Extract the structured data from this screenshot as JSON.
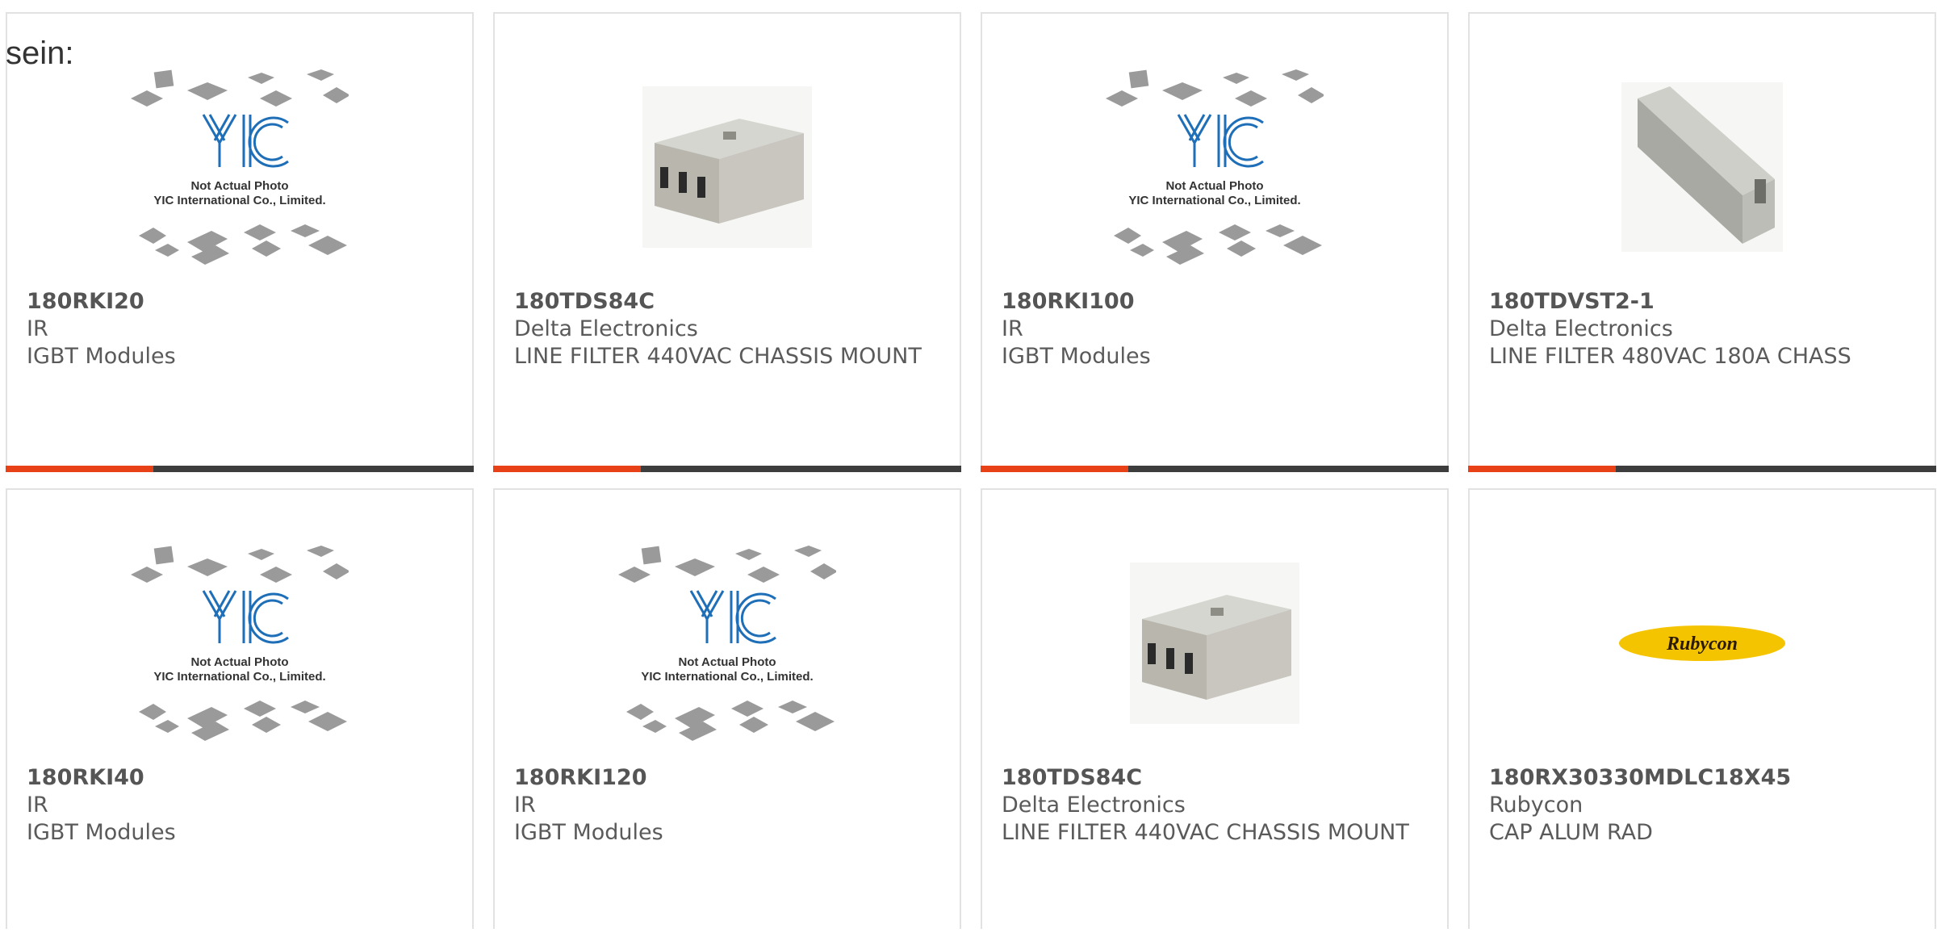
{
  "intro_text": "sein:",
  "placeholder": {
    "line1": "Not Actual Photo",
    "line2": "YIC International Co., Limited.",
    "logo_text": "YIC"
  },
  "rubycon_logo": "Rubycon",
  "products": [
    {
      "part": "180RKI20",
      "brand": "IR",
      "desc": "IGBT Modules",
      "image": "yic-placeholder"
    },
    {
      "part": "180TDS84C",
      "brand": "Delta Electronics",
      "desc": "LINE FILTER 440VAC CHASSIS MOUNT",
      "image": "line-filter-box"
    },
    {
      "part": "180RKI100",
      "brand": "IR",
      "desc": "IGBT Modules",
      "image": "yic-placeholder"
    },
    {
      "part": "180TDVST2-1",
      "brand": "Delta Electronics",
      "desc": "LINE FILTER 480VAC 180A CHASS",
      "image": "line-filter-long"
    },
    {
      "part": "180RKI40",
      "brand": "IR",
      "desc": "IGBT Modules",
      "image": "yic-placeholder"
    },
    {
      "part": "180RKI120",
      "brand": "IR",
      "desc": "IGBT Modules",
      "image": "yic-placeholder"
    },
    {
      "part": "180TDS84C",
      "brand": "Delta Electronics",
      "desc": "LINE FILTER 440VAC CHASSIS MOUNT",
      "image": "line-filter-box"
    },
    {
      "part": "180RX30330MDLC18X45",
      "brand": "Rubycon",
      "desc": "CAP ALUM RAD",
      "image": "rubycon-logo"
    }
  ],
  "colors": {
    "accent": "#e84017",
    "bar": "#3d3d3d",
    "text": "#5a5a5a",
    "logo_blue": "#1f6fb8",
    "rubycon_yellow": "#f5c400"
  }
}
